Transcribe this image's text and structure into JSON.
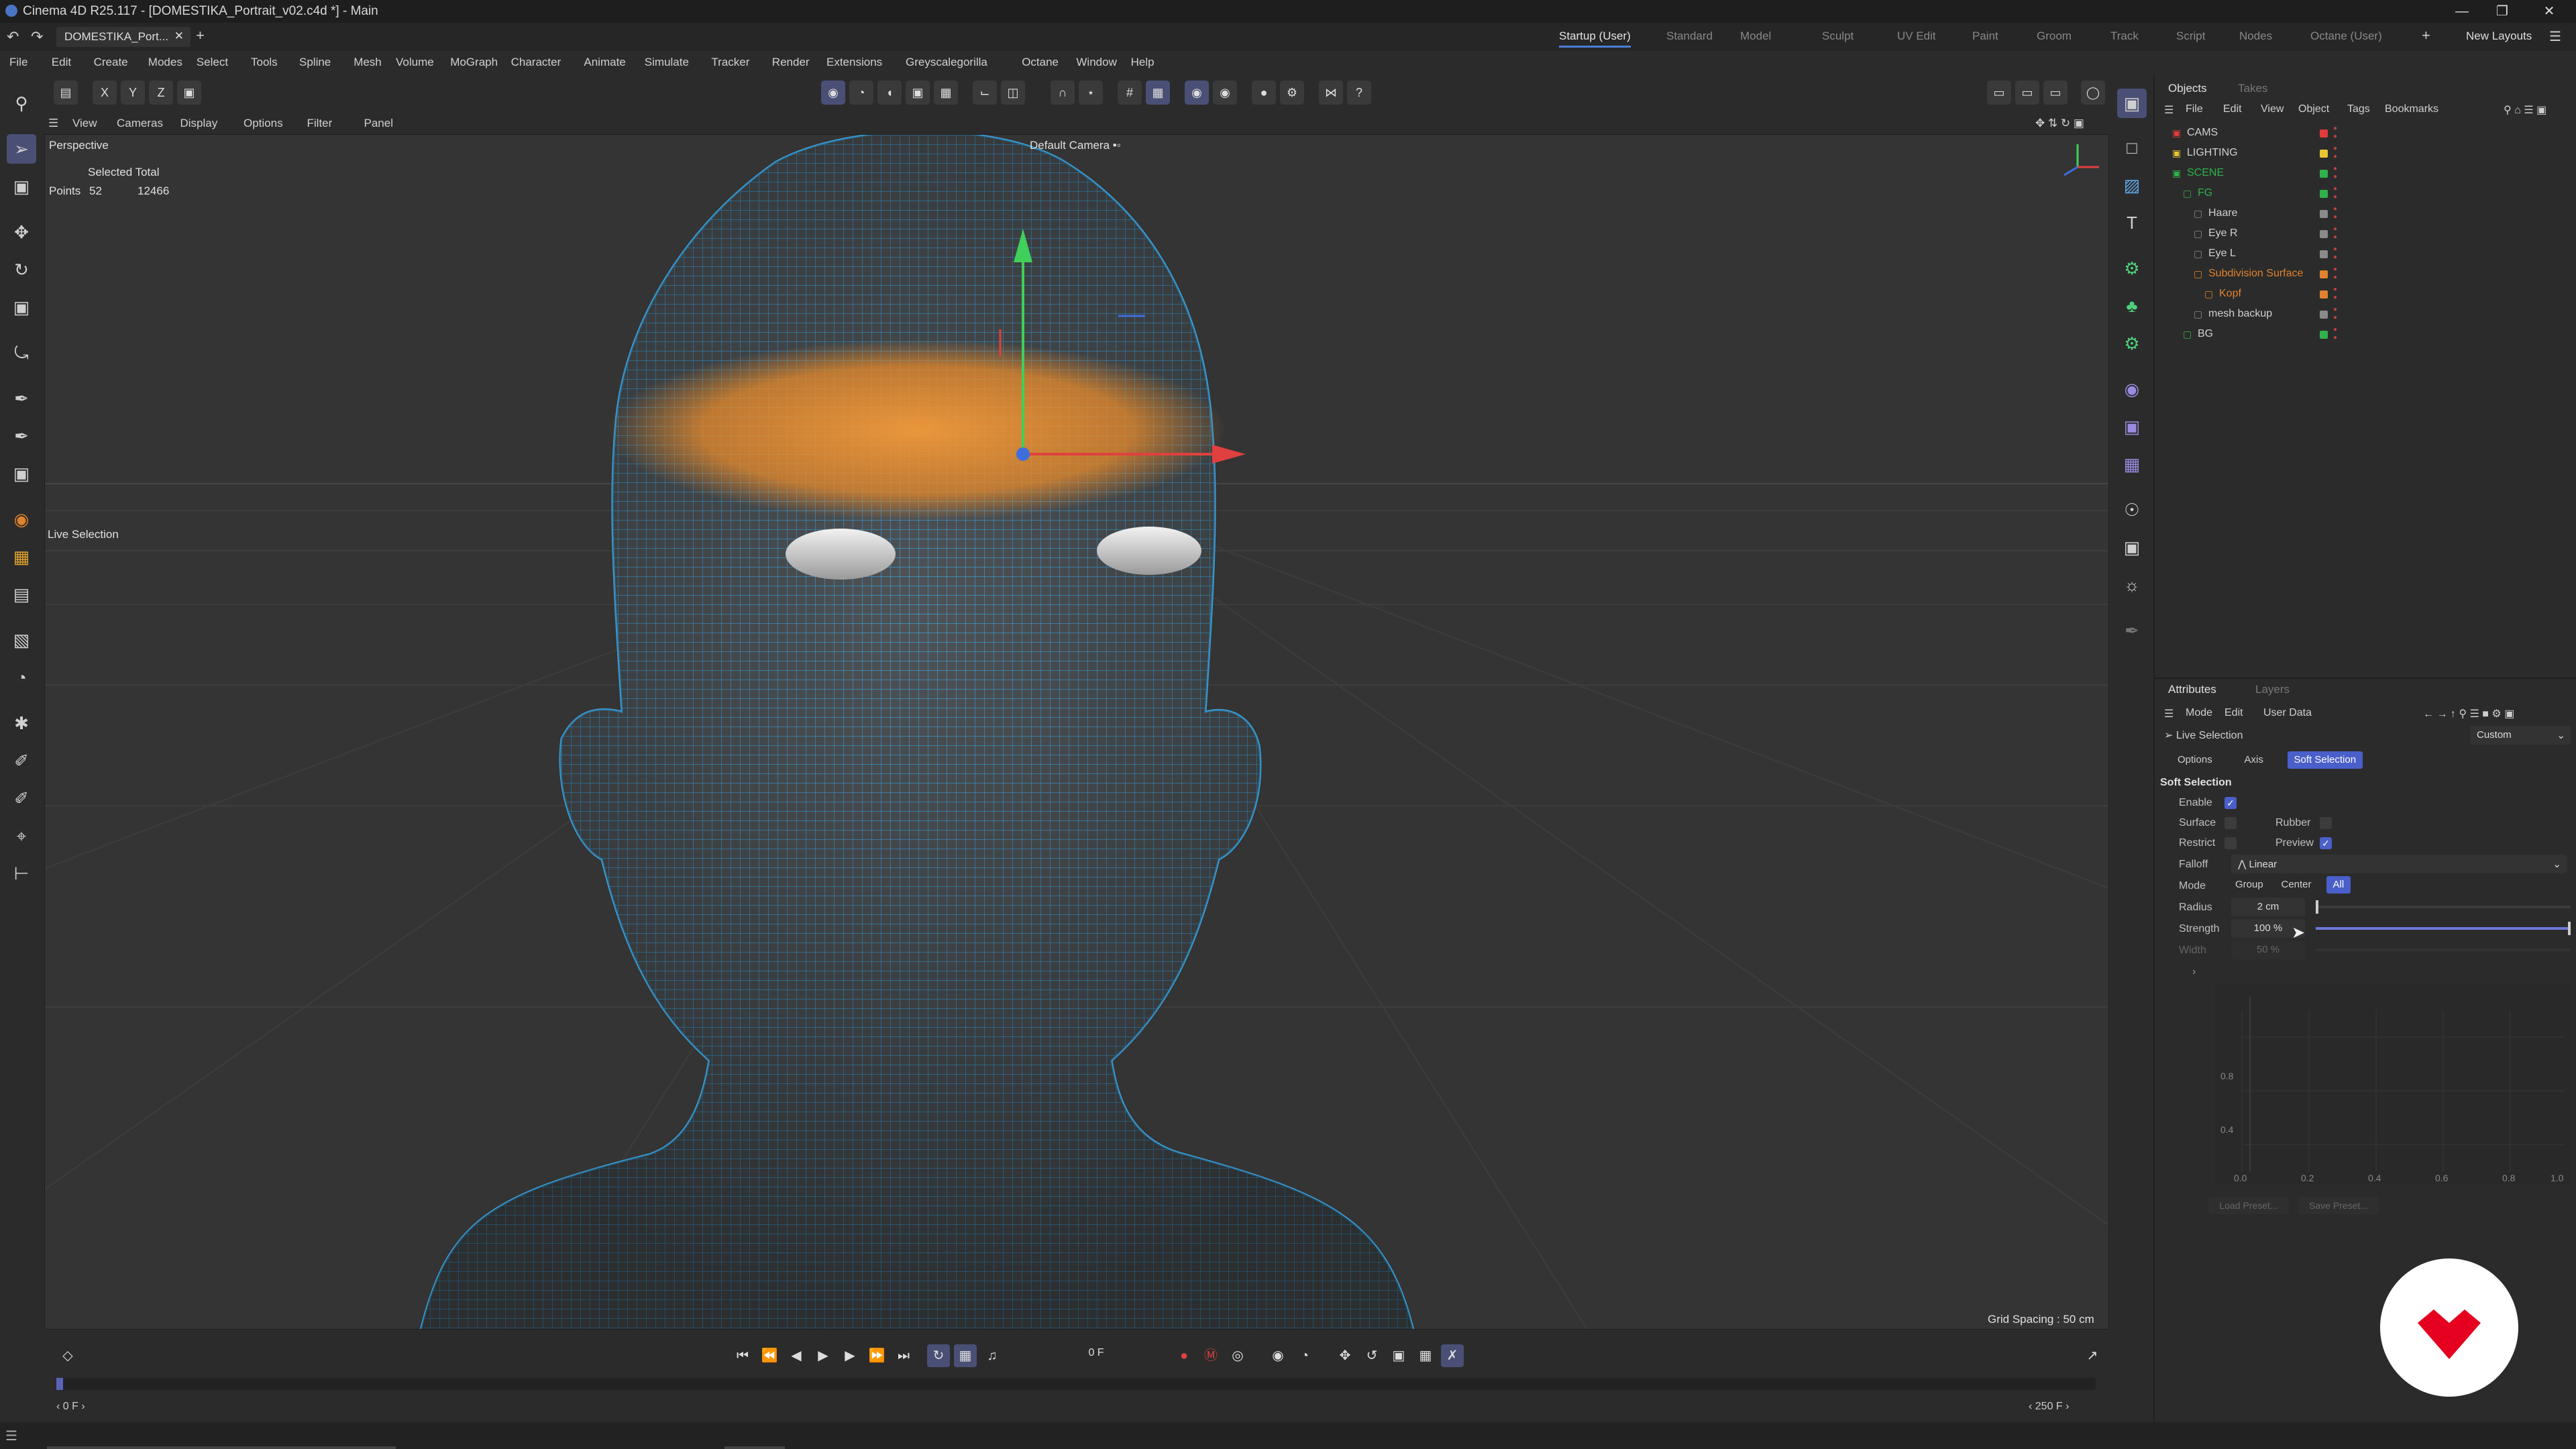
{
  "app": {
    "window_title": "Cinema 4D R25.117 - [DOMESTIKA_Portrait_v02.c4d *] - Main",
    "document_tab": "DOMESTIKA_Port...",
    "layouts": [
      "Startup (User)",
      "Standard",
      "Model",
      "Sculpt",
      "UV Edit",
      "Paint",
      "Groom",
      "Track",
      "Script",
      "Nodes",
      "Octane (User)"
    ],
    "active_layout": "Startup (User)",
    "new_layouts": "New Layouts"
  },
  "menubar": [
    "File",
    "Edit",
    "Create",
    "Modes",
    "Select",
    "Tools",
    "Spline",
    "Mesh",
    "Volume",
    "MoGraph",
    "Character",
    "Animate",
    "Simulate",
    "Tracker",
    "Render",
    "Extensions",
    "Greyscalegorilla",
    "Octane",
    "Window",
    "Help"
  ],
  "toolbar": {
    "axis_x": "X",
    "axis_y": "Y",
    "axis_z": "Z"
  },
  "viewport": {
    "menu": [
      "View",
      "Cameras",
      "Display",
      "Options",
      "Filter",
      "Panel"
    ],
    "name": "Perspective",
    "camera": "Default Camera",
    "camera_suffix": "•◦",
    "selected_total": "Selected Total",
    "points_label": "Points",
    "points_selected": "52",
    "points_total": "12466",
    "tool_hint": "Live Selection",
    "grid_spacing": "Grid Spacing : 50 cm"
  },
  "timeline": {
    "current_frame": "0 F",
    "start_frame": "0 F",
    "end_frame": "250 F"
  },
  "objects": {
    "tabs": [
      "Objects",
      "Takes"
    ],
    "menu": [
      "File",
      "Edit",
      "View",
      "Object",
      "Tags",
      "Bookmarks"
    ],
    "items": [
      {
        "name": "CAMS",
        "color": "#e23b3b",
        "indent": 0
      },
      {
        "name": "LIGHTING",
        "color": "#e6c632",
        "indent": 0
      },
      {
        "name": "SCENE",
        "color": "#2fb24a",
        "indent": 0
      },
      {
        "name": "FG",
        "color": "#2fb24a",
        "indent": 1
      },
      {
        "name": "Haare",
        "color": "#8a8a8a",
        "indent": 2
      },
      {
        "name": "Eye R",
        "color": "#8a8a8a",
        "indent": 2
      },
      {
        "name": "Eye L",
        "color": "#8a8a8a",
        "indent": 2
      },
      {
        "name": "Subdivision Surface",
        "color": "#e0822e",
        "indent": 2
      },
      {
        "name": "Kopf",
        "color": "#e0822e",
        "indent": 3
      },
      {
        "name": "mesh backup",
        "color": "#8a8a8a",
        "indent": 2
      },
      {
        "name": "BG",
        "color": "#2fb24a",
        "indent": 1
      }
    ]
  },
  "attributes": {
    "tabs": [
      "Attributes",
      "Layers"
    ],
    "menu": [
      "Mode",
      "Edit",
      "User Data"
    ],
    "tool_name": "Live Selection",
    "preset": "Custom",
    "subtabs": [
      "Options",
      "Axis",
      "Soft Selection"
    ],
    "active_subtab": "Soft Selection",
    "section": "Soft Selection",
    "enable_label": "Enable",
    "surface_label": "Surface",
    "rubber_label": "Rubber",
    "restrict_label": "Restrict",
    "preview_label": "Preview",
    "falloff_label": "Falloff",
    "falloff_value": "Linear",
    "mode_label": "Mode",
    "mode_options": [
      "Group",
      "Center",
      "All"
    ],
    "mode_selected": "All",
    "radius_label": "Radius",
    "radius_value": "2 cm",
    "strength_label": "Strength",
    "strength_value": "100 %",
    "strength": 1.0,
    "width_label": "Width",
    "width_value": "50 %",
    "graph_y_ticks": [
      "0.8",
      "0.4"
    ],
    "graph_x_ticks": [
      "0.0",
      "0.2",
      "0.4",
      "0.6",
      "0.8",
      "1.0"
    ],
    "load_preset": "Load Preset...",
    "save_preset": "Save Preset..."
  },
  "colors": {
    "accent": "#4a5fc9",
    "selection": "#e88a2a",
    "wire": "#4aa0d8",
    "brand": "#e5001f"
  }
}
